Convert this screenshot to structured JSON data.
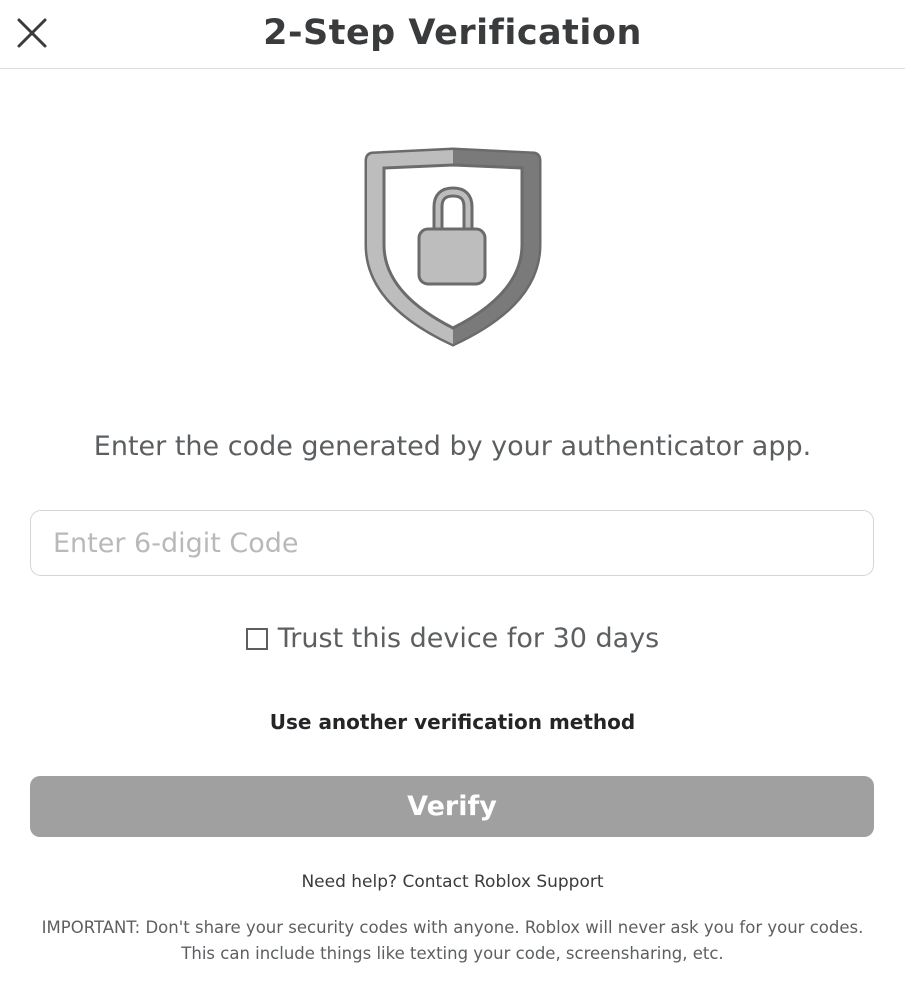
{
  "header": {
    "title": "2-Step Verification",
    "close_icon": "close-icon"
  },
  "illustration": {
    "icon": "shield-lock-icon",
    "colors": {
      "shield_left": "#bdbdbd",
      "shield_right": "#7a7a7a",
      "outline": "#6b6b6b"
    }
  },
  "instruction": "Enter the code generated by your authenticator app.",
  "code_input": {
    "value": "",
    "placeholder": "Enter 6-digit Code"
  },
  "trust_device": {
    "checked": false,
    "label": "Trust this device for 30 days"
  },
  "alt_method_label": "Use another verification method",
  "verify": {
    "label": "Verify",
    "enabled": false,
    "color": "#a0a0a1"
  },
  "help": {
    "prefix": "Need help?",
    "link": "Contact Roblox Support"
  },
  "important_notice": "IMPORTANT: Don't share your security codes with anyone. Roblox will never ask you for your codes. This can include things like texting your code, screensharing, etc."
}
